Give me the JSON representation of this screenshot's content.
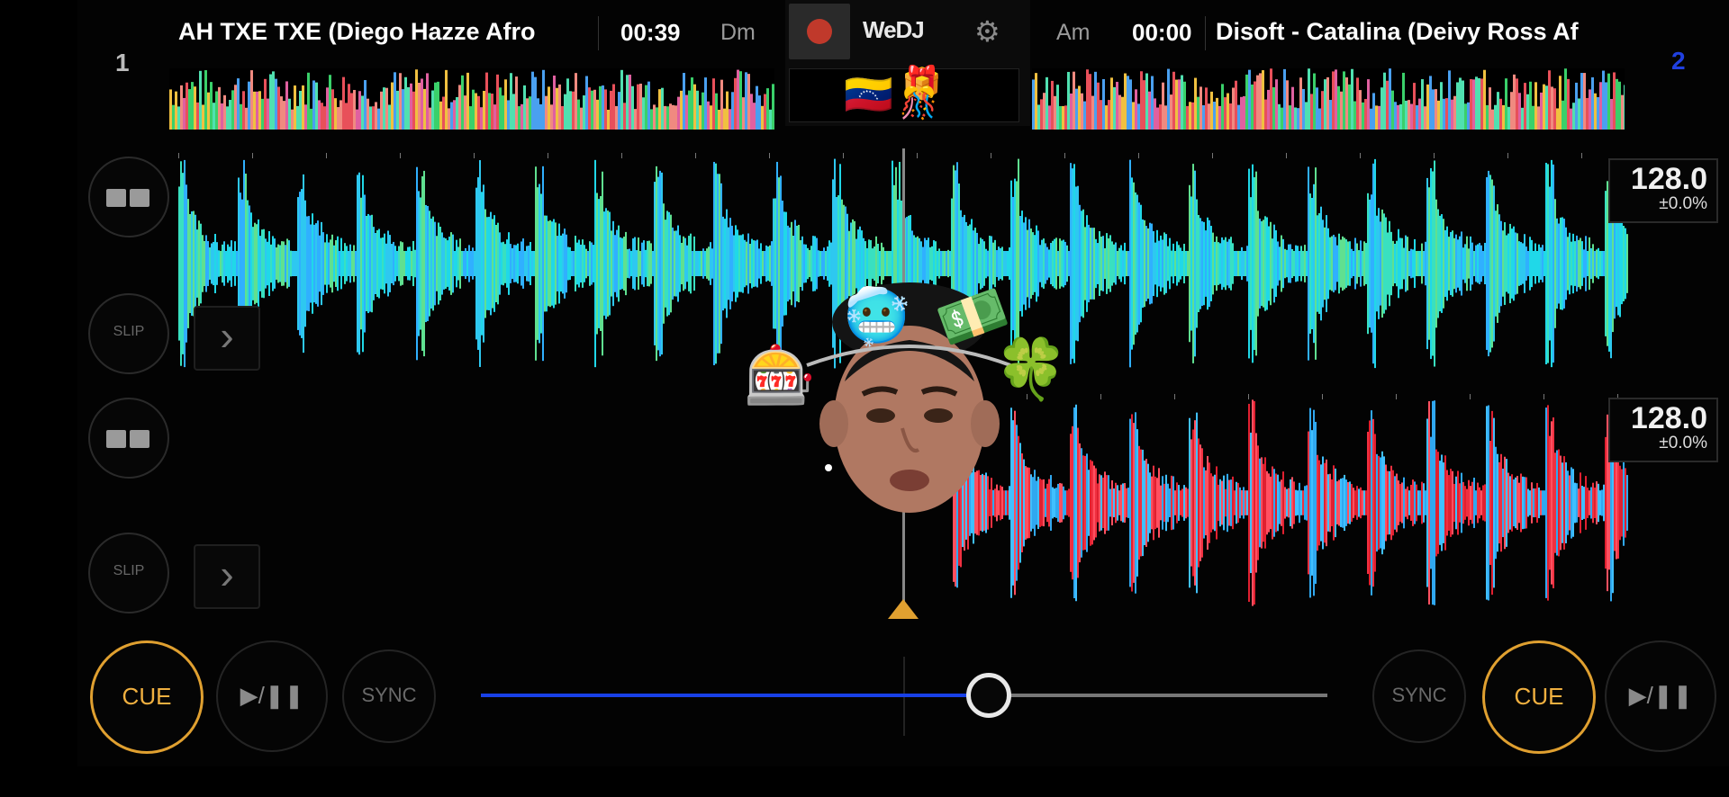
{
  "app": {
    "name": "WeDJ",
    "record_label": "record"
  },
  "deck1": {
    "number": "1",
    "title": "AH TXE TXE (Diego Hazze Afro",
    "time": "00:39",
    "key": "Dm",
    "bpm": "128.0",
    "pitch": "±0.0%",
    "slip_label": "SLIP",
    "cue_label": "CUE",
    "play_label": "▶/❚❚",
    "sync_label": "SYNC",
    "progress": 0.42
  },
  "deck2": {
    "number": "2",
    "title": "Disoft - Catalina (Deivy Ross Af",
    "time": "00:00",
    "key": "Am",
    "bpm": "128.0",
    "pitch": "±0.0%",
    "slip_label": "SLIP",
    "cue_label": "CUE",
    "play_label": "▶/❚❚",
    "sync_label": "SYNC",
    "progress": 0.0
  },
  "crossfader": {
    "position": 0.6
  },
  "overlay": {
    "flag_emoji": "🇻🇪",
    "gift_emoji": "🎁",
    "party_emoji": "🎊",
    "freeze_emoji": "🥶",
    "money_emoji": "💵",
    "slot_emoji": "🎰",
    "clover_emoji": "🍀"
  },
  "icons": {
    "settings": "gear-icon",
    "forward": "chevron-right-icon"
  },
  "colors": {
    "accent": "#e0a030",
    "xfader": "#1840e8",
    "deck2_num": "#2040e0"
  }
}
